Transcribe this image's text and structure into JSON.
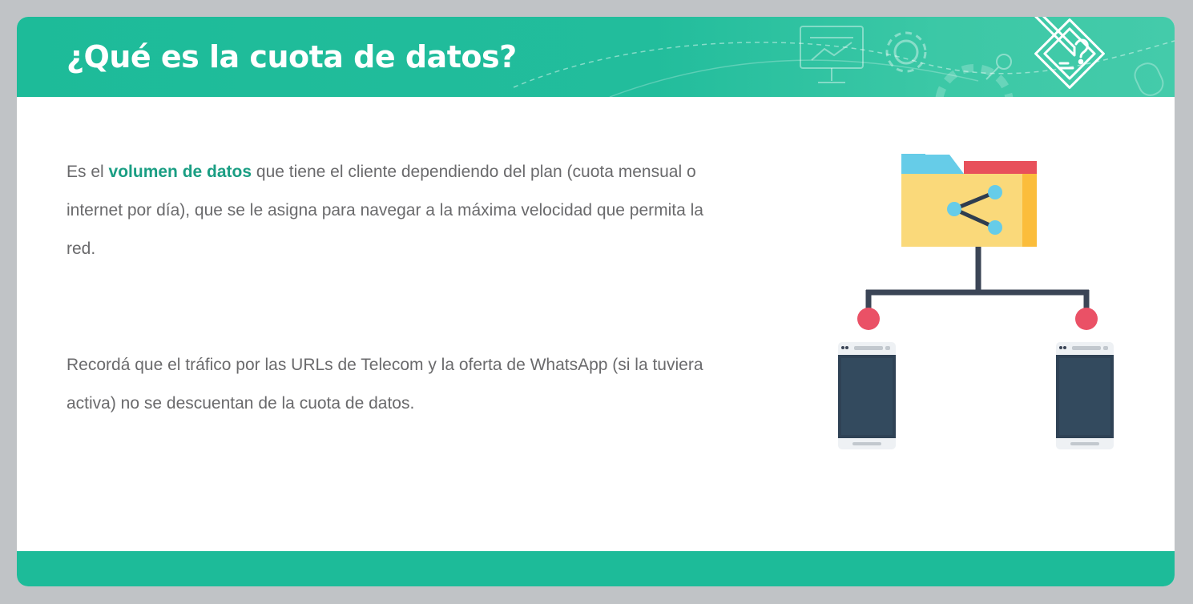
{
  "header": {
    "title": "¿Qué es la cuota de datos?",
    "brand_icon": "pencil-checklist-icon"
  },
  "content": {
    "paragraph1": {
      "prefix": "Es el ",
      "highlight": "volumen de datos",
      "suffix": " que tiene el cliente dependiendo del plan (cuota mensual o internet por día), que se le asigna para navegar a la máxima velocidad que permita la red."
    },
    "paragraph2": "Recordá que el tráfico por las URLs de Telecom y la oferta de WhatsApp (si la tuviera activa) no se descuentan de la cuota de datos."
  },
  "illustration": {
    "icons": [
      "shared-folder-icon",
      "network-node-icon",
      "smartphone-icon"
    ]
  },
  "colors": {
    "accent": "#1dbb99",
    "highlight": "#1a9e83",
    "text": "#6a6a6c",
    "background": "#c0c3c6"
  }
}
